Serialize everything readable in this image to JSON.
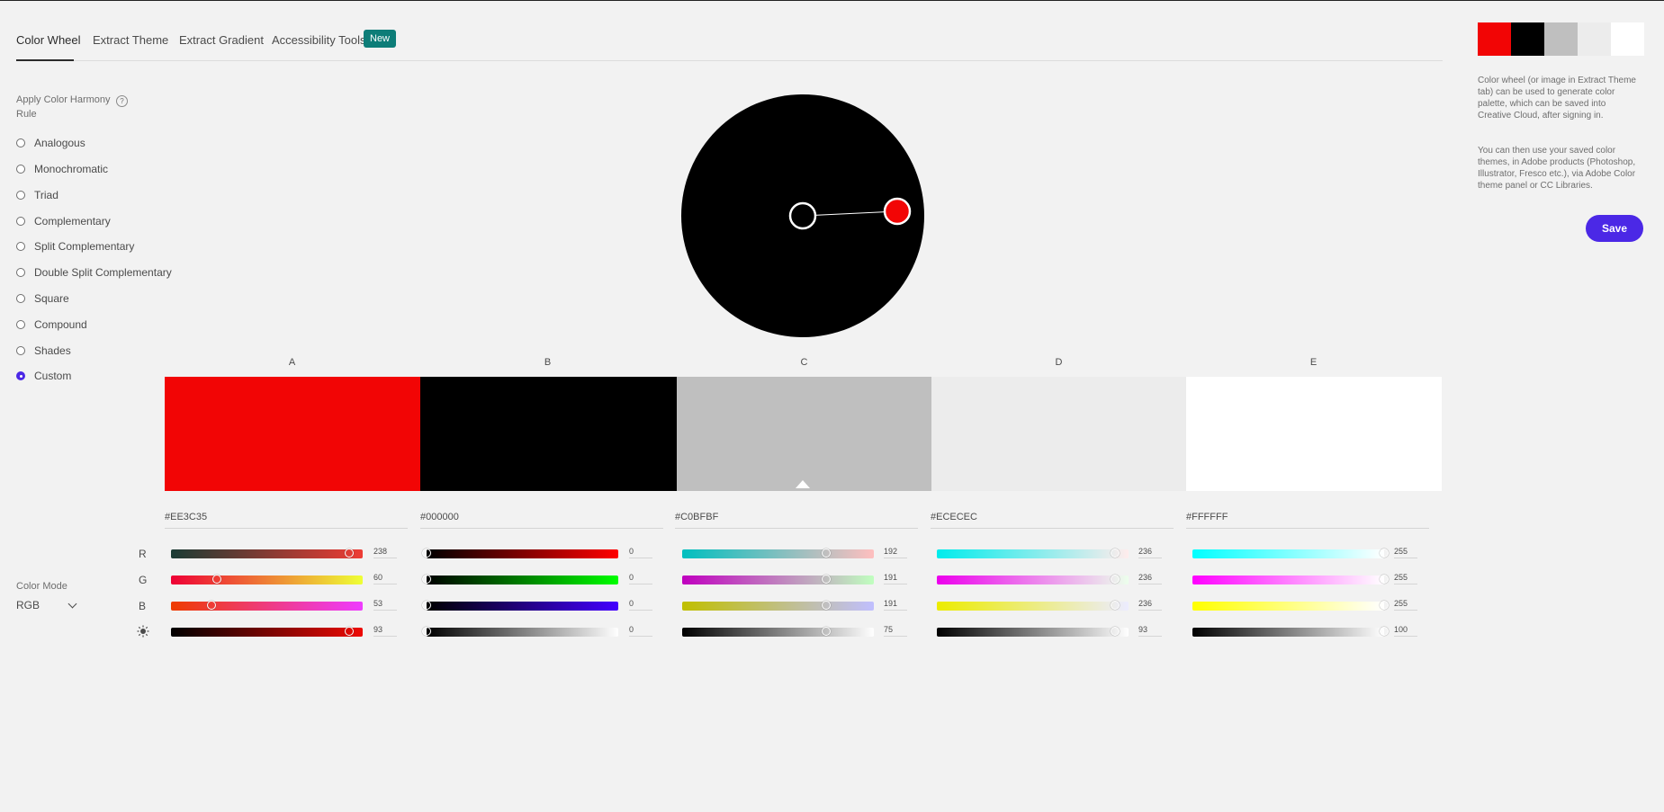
{
  "tabs": [
    {
      "label": "Color Wheel"
    },
    {
      "label": "Extract Theme"
    },
    {
      "label": "Extract Gradient"
    },
    {
      "label": "Accessibility Tools"
    }
  ],
  "new_badge": "New",
  "harmony": {
    "title": "Apply Color Harmony Rule",
    "help_icon": "?",
    "options": [
      {
        "label": "Analogous"
      },
      {
        "label": "Monochromatic"
      },
      {
        "label": "Triad"
      },
      {
        "label": "Complementary"
      },
      {
        "label": "Split Complementary"
      },
      {
        "label": "Double Split Complementary"
      },
      {
        "label": "Square"
      },
      {
        "label": "Compound"
      },
      {
        "label": "Shades"
      },
      {
        "label": "Custom"
      }
    ],
    "selected": "Custom"
  },
  "columns": [
    {
      "letter": "A",
      "color": "#F20505",
      "hex": "#EE3C35",
      "r": "238",
      "g": "60",
      "b": "53",
      "brightness": "93",
      "r_frac": 0.93,
      "g_frac": 0.24,
      "b_frac": 0.21,
      "br_frac": 0.93
    },
    {
      "letter": "B",
      "color": "#000000",
      "hex": "#000000",
      "r": "0",
      "g": "0",
      "b": "0",
      "brightness": "0",
      "r_frac": 0.0,
      "g_frac": 0.0,
      "b_frac": 0.0,
      "br_frac": 0.0
    },
    {
      "letter": "C",
      "color": "#BFBFBF",
      "hex": "#C0BFBF",
      "r": "192",
      "g": "191",
      "b": "191",
      "brightness": "75",
      "r_frac": 0.75,
      "g_frac": 0.75,
      "b_frac": 0.75,
      "br_frac": 0.75
    },
    {
      "letter": "D",
      "color": "#ECECEC",
      "hex": "#ECECEC",
      "r": "236",
      "g": "236",
      "b": "236",
      "brightness": "93",
      "r_frac": 0.93,
      "g_frac": 0.93,
      "b_frac": 0.93,
      "br_frac": 0.93
    },
    {
      "letter": "E",
      "color": "#FFFFFF",
      "hex": "#FFFFFF",
      "r": "255",
      "g": "255",
      "b": "255",
      "brightness": "100",
      "r_frac": 1.0,
      "g_frac": 1.0,
      "b_frac": 1.0,
      "br_frac": 1.0
    }
  ],
  "row_labels": {
    "r": "R",
    "g": "G",
    "b": "B",
    "brightness_icon": "sun-icon"
  },
  "color_mode": {
    "title": "Color Mode",
    "value": "RGB"
  },
  "description": [
    "Color wheel (or image in Extract Theme tab) can be used to generate color palette, which can be saved into Creative Cloud, after signing in.",
    "You can then use your saved color themes, in Adobe products (Photoshop, Illustrator, Fresco etc.), via Adobe Color theme panel or CC Libraries."
  ],
  "save_label": "Save",
  "accent_color": "#4B28E6",
  "badge_color": "#0D7D78"
}
